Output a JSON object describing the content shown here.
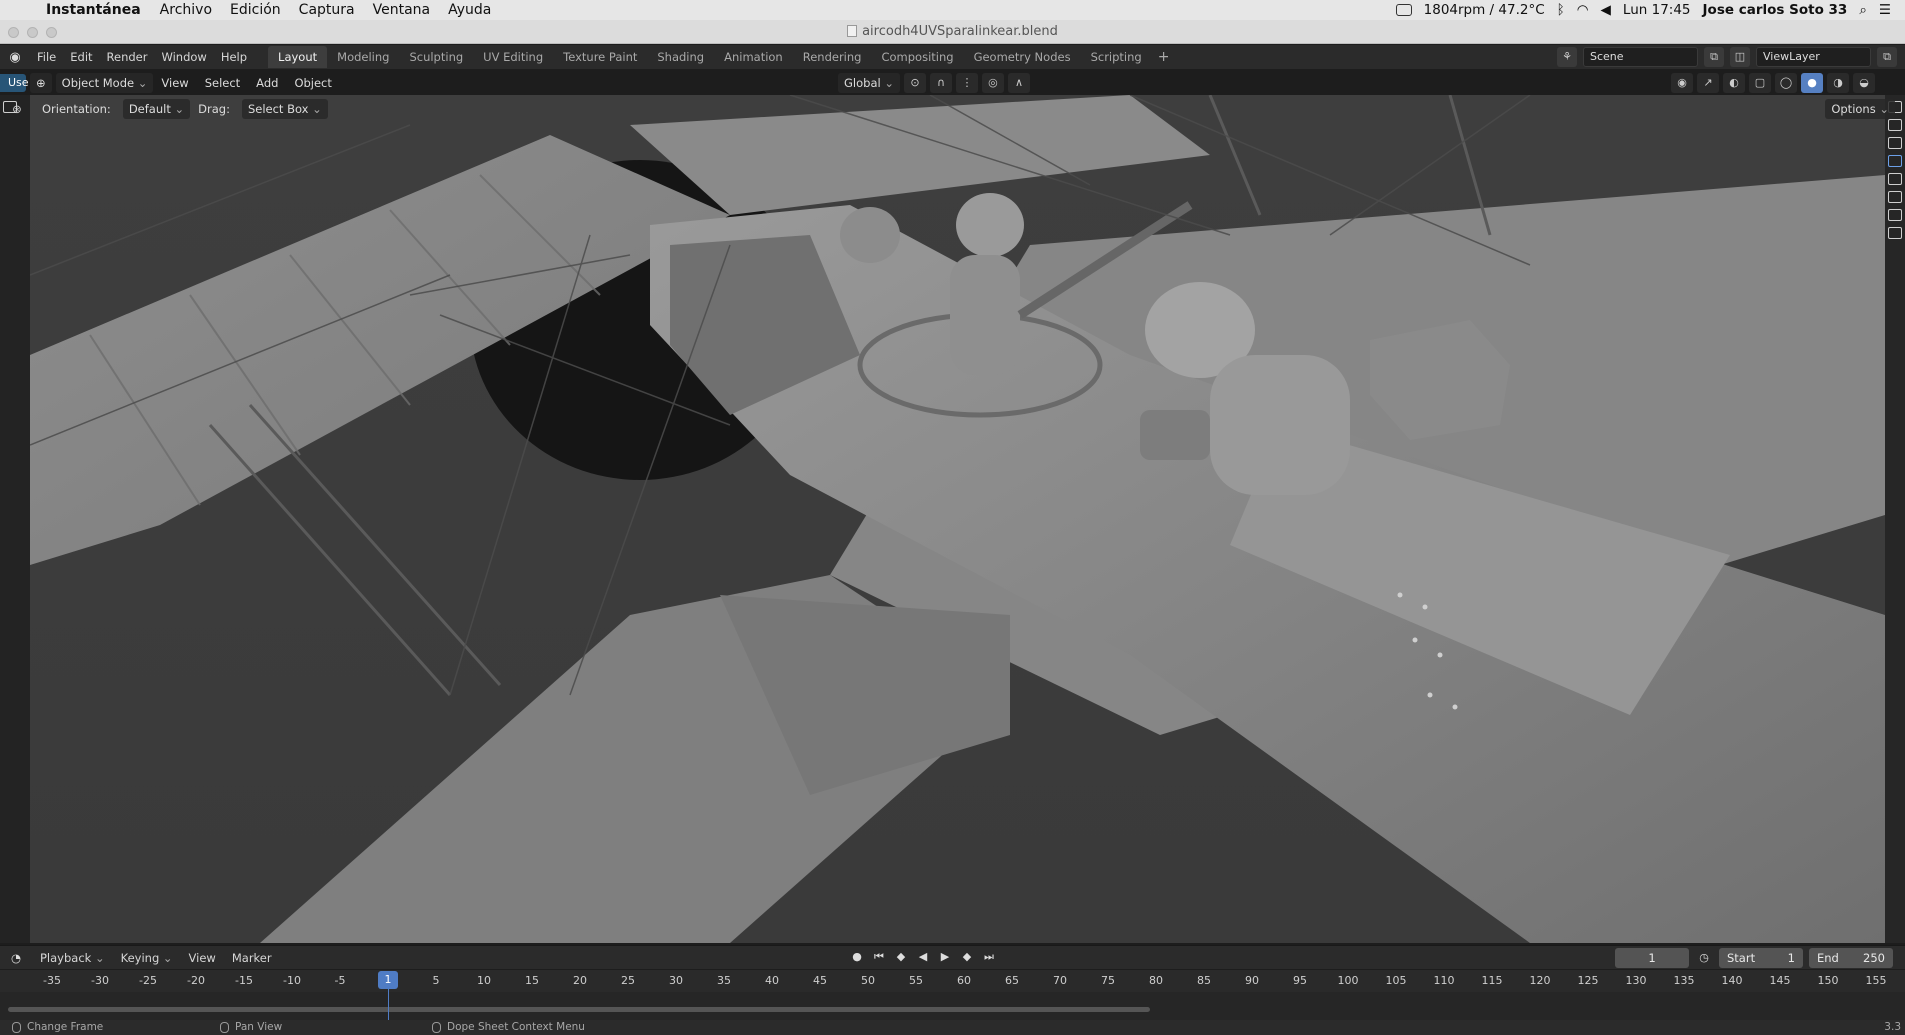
{
  "mac_menubar": {
    "app_name": "Instantánea",
    "menus": [
      "Archivo",
      "Edición",
      "Captura",
      "Ventana",
      "Ayuda"
    ],
    "status": {
      "fan": "1804rpm / 47.2°C",
      "clock": "Lun 17:45",
      "user": "Jose carlos Soto 33"
    }
  },
  "window": {
    "title": "aircodh4UVSparalinkear.blend"
  },
  "topbar": {
    "menus": [
      "File",
      "Edit",
      "Render",
      "Window",
      "Help"
    ],
    "workspaces": [
      "Layout",
      "Modeling",
      "Sculpting",
      "UV Editing",
      "Texture Paint",
      "Shading",
      "Animation",
      "Rendering",
      "Compositing",
      "Geometry Nodes",
      "Scripting"
    ],
    "active_workspace": "Layout",
    "add_workspace": "+",
    "scene": "Scene",
    "view_layer": "ViewLayer"
  },
  "viewport_header": {
    "use_tab": "Use",
    "mode": "Object Mode",
    "menus": [
      "View",
      "Select",
      "Add",
      "Object"
    ],
    "transform_orientation": "Global",
    "orientation_label": "Orientation:",
    "orientation_value": "Default",
    "drag_label": "Drag:",
    "drag_value": "Select Box",
    "options": "Options"
  },
  "icons": {
    "blender": "blender-logo-icon",
    "scene": "scene-icon",
    "view_layer": "view-layer-icon",
    "snap": "magnet-icon",
    "proportional": "proportional-edit-icon",
    "shading_solid": "solid-shading-icon"
  },
  "timeline": {
    "menus": [
      "Playback",
      "Keying",
      "View",
      "Marker"
    ],
    "current_frame": "1",
    "start_label": "Start",
    "start": "1",
    "end_label": "End",
    "end": "250",
    "ruler": [
      "-35",
      "-30",
      "-25",
      "-20",
      "-15",
      "-10",
      "-5",
      "1",
      "5",
      "10",
      "15",
      "20",
      "25",
      "30",
      "35",
      "40",
      "45",
      "50",
      "55",
      "60",
      "65",
      "70",
      "75",
      "80",
      "85",
      "90",
      "95",
      "100",
      "105",
      "110",
      "115",
      "120",
      "125",
      "130",
      "135",
      "140",
      "145",
      "150",
      "155"
    ],
    "playhead": "1"
  },
  "statusbar": {
    "items": [
      "Change Frame",
      "Pan View",
      "Dope Sheet Context Menu"
    ],
    "version": "3.3"
  }
}
